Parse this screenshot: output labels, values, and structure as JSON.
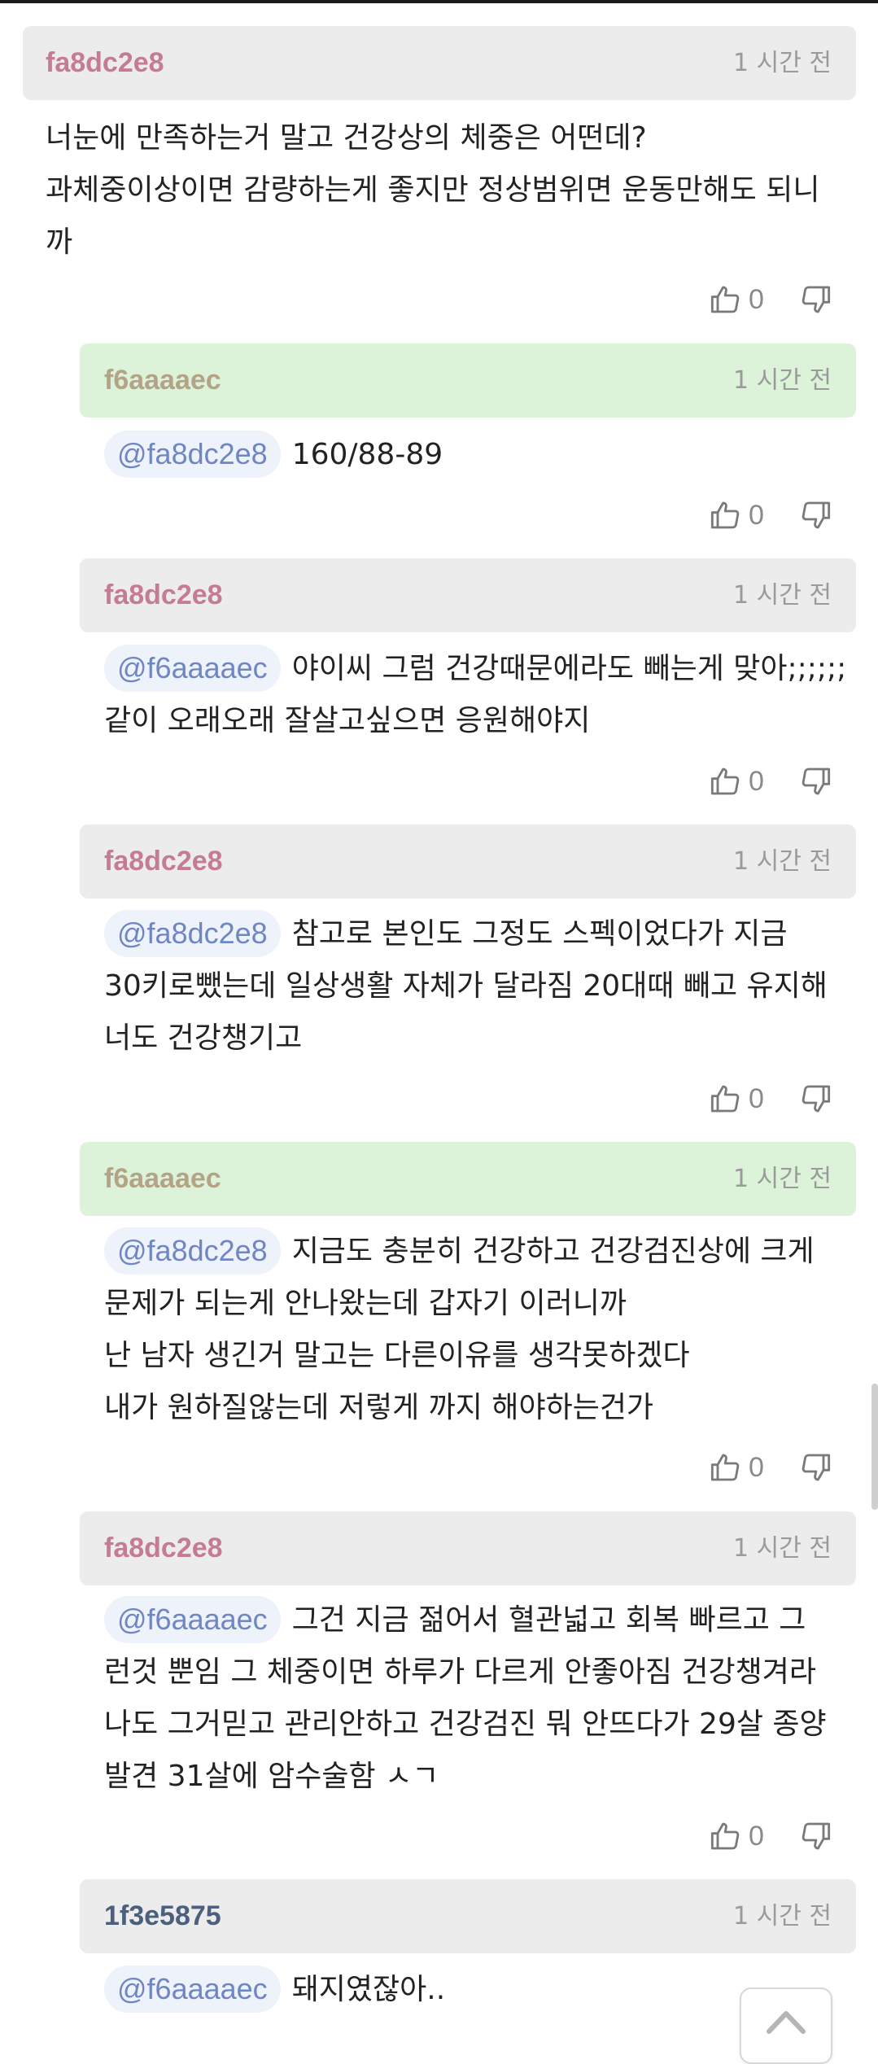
{
  "comments": [
    {
      "author": "fa8dc2e8",
      "time": "1 시간 전",
      "lines": [
        "너눈에 만족하는거 말고 건강상의 체중은 어떤데?",
        "과체중이상이면 감량하는게 좋지만 정상범위면 운동만해도 되니",
        "까"
      ],
      "likes": "0"
    },
    {
      "author": "f6aaaaec",
      "time": "1 시간 전",
      "mention": "@fa8dc2e8",
      "lines": [
        "160/88-89"
      ],
      "likes": "0"
    },
    {
      "author": "fa8dc2e8",
      "time": "1 시간 전",
      "mention": "@f6aaaaec",
      "lines": [
        "야이씨 그럼 건강때문에라도 빼는게 맞아;;;;;;",
        "같이 오래오래 잘살고싶으면 응원해야지"
      ],
      "likes": "0"
    },
    {
      "author": "fa8dc2e8",
      "time": "1 시간 전",
      "mention": "@fa8dc2e8",
      "lines": [
        "참고로 본인도 그정도 스펙이었다가 지금",
        "30키로뺐는데 일상생활 자체가 달라짐 20대때 빼고 유지해",
        "너도 건강챙기고"
      ],
      "likes": "0"
    },
    {
      "author": "f6aaaaec",
      "time": "1 시간 전",
      "mention": "@fa8dc2e8",
      "lines": [
        "지금도 충분히 건강하고 건강검진상에 크게",
        "문제가 되는게 안나왔는데 갑자기 이러니까",
        "난 남자 생긴거 말고는 다른이유를 생각못하겠다",
        "내가 원하질않는데 저렇게 까지 해야하는건가"
      ],
      "likes": "0"
    },
    {
      "author": "fa8dc2e8",
      "time": "1 시간 전",
      "mention": "@f6aaaaec",
      "lines": [
        "그건 지금 젊어서 혈관넓고 회복 빠르고 그",
        "런것 뿐임 그 체중이면 하루가 다르게 안좋아짐 건강챙겨라",
        "나도 그거믿고 관리안하고 건강검진 뭐 안뜨다가 29살 종양",
        "발견 31살에 암수술함 ㅅㄱ"
      ],
      "likes": "0"
    },
    {
      "author": "1f3e5875",
      "time": "1 시간 전",
      "mention": "@f6aaaaec",
      "lines": [
        "돼지였잖아.."
      ]
    }
  ],
  "icons": {
    "like": "thumbs-up-icon",
    "dislike": "thumbs-down-icon",
    "scroll_top": "chevron-up-icon"
  },
  "colors": {
    "author_default": "#c57b93",
    "author_op": "#b3a487",
    "author_other": "#4c5f7c",
    "op_header_bg": "#dcf3da",
    "header_bg": "#ececec",
    "mention_text": "#6f86c4",
    "mention_bg": "#eef2fb"
  }
}
